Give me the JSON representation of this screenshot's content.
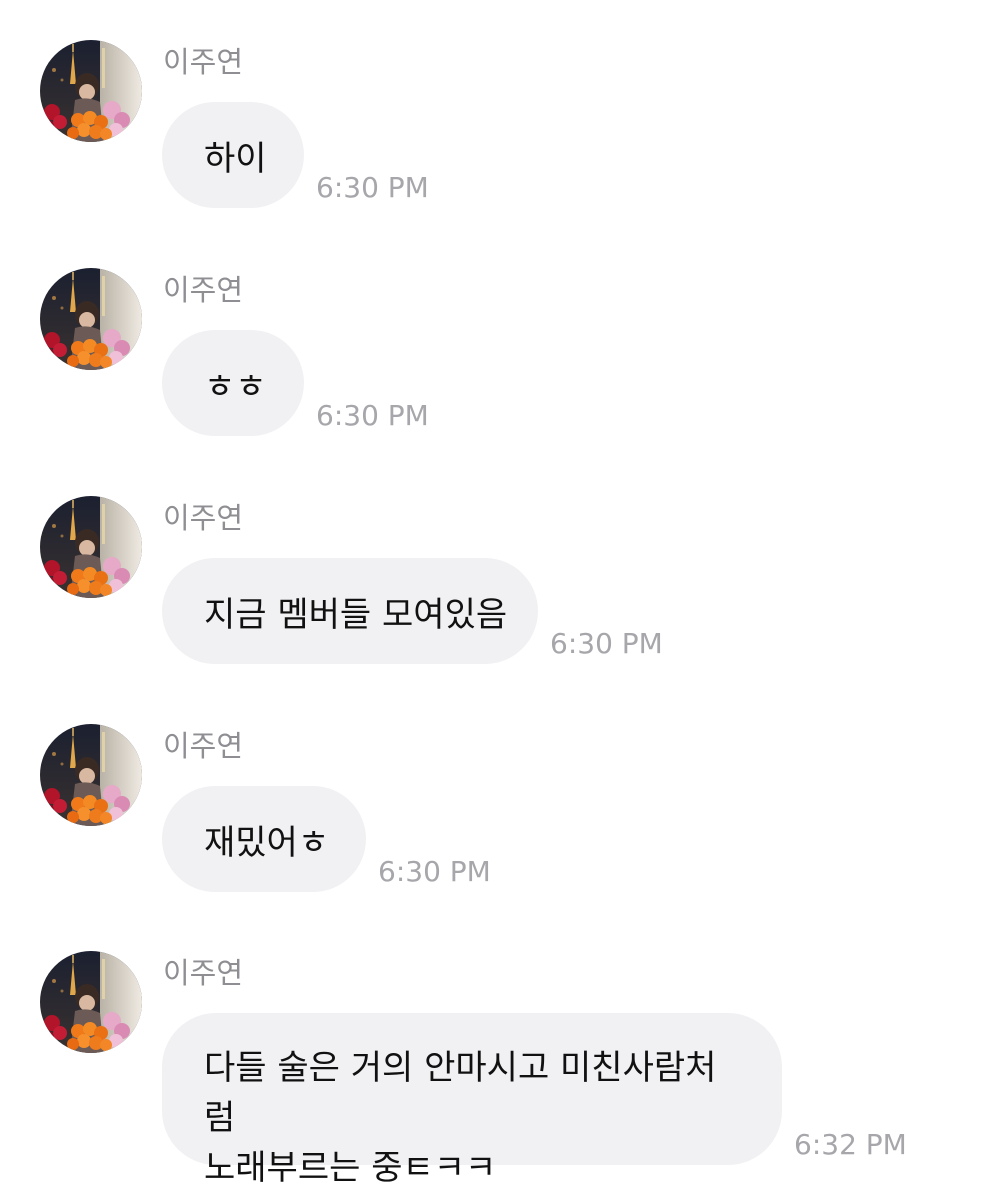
{
  "messages": [
    {
      "sender": "이주연",
      "text": "하이",
      "time": "6:30 PM"
    },
    {
      "sender": "이주연",
      "text": "ㅎㅎ",
      "time": "6:30 PM"
    },
    {
      "sender": "이주연",
      "text": "지금 멤버들 모여있음",
      "time": "6:30 PM"
    },
    {
      "sender": "이주연",
      "text": "재밌어ㅎ",
      "time": "6:30 PM"
    },
    {
      "sender": "이주연",
      "text": "다들 술은 거의 안마시고 미친사람처럼\n노래부르는 중ㅌㅋㅋ",
      "time": "6:32 PM"
    }
  ],
  "colors": {
    "bubble": "#f1f1f4",
    "sender_name": "#8e8e93",
    "timestamp": "#a6a6ab",
    "message_text": "#111111"
  },
  "icons": {
    "avatar": "profile-photo-avatar"
  }
}
